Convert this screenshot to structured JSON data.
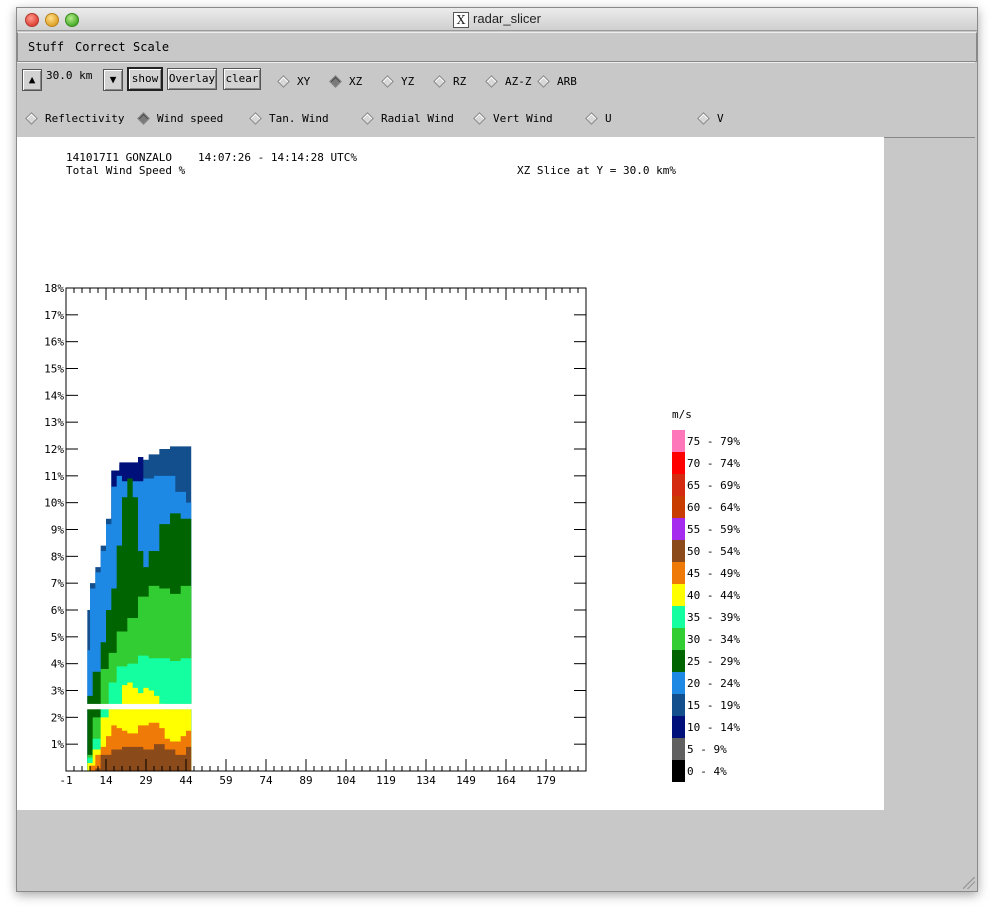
{
  "window": {
    "title": "radar_slicer"
  },
  "menu": [
    "Stuff",
    "Correct",
    "Scale"
  ],
  "toolbar": {
    "up_arrow": "▲",
    "down_arrow": "▼",
    "height_value": "30.0 km",
    "show": "show",
    "overlay": "Overlay",
    "clear": "clear",
    "slice_modes": [
      {
        "label": "XY",
        "selected": false
      },
      {
        "label": "XZ",
        "selected": true
      },
      {
        "label": "YZ",
        "selected": false
      },
      {
        "label": "RZ",
        "selected": false
      },
      {
        "label": "AZ-Z",
        "selected": false
      },
      {
        "label": "ARB",
        "selected": false
      }
    ],
    "fields": [
      {
        "label": "Reflectivity",
        "selected": false
      },
      {
        "label": "Wind speed",
        "selected": true
      },
      {
        "label": "Tan. Wind",
        "selected": false
      },
      {
        "label": "Radial Wind",
        "selected": false
      },
      {
        "label": "Vert Wind",
        "selected": false
      },
      {
        "label": "U",
        "selected": false
      },
      {
        "label": "V",
        "selected": false
      }
    ]
  },
  "plot_header": {
    "flight": "141017I1 GONZALO",
    "time_range": "14:07:26 - 14:14:28 UTC%",
    "field_name": "Total Wind Speed %",
    "slice_desc": "XZ Slice at Y = 30.0 km%"
  },
  "chart_data": {
    "type": "heatmap",
    "xlim": [
      -1,
      194
    ],
    "ylim": [
      0,
      18
    ],
    "x_ticks": [
      "-1",
      "14",
      "29",
      "44",
      "59",
      "74",
      "89",
      "104",
      "119",
      "134",
      "149",
      "164",
      "179"
    ],
    "y_ticks": [
      "1%",
      "2%",
      "3%",
      "4%",
      "5%",
      "6%",
      "7%",
      "8%",
      "9%",
      "10%",
      "11%",
      "12%",
      "13%",
      "14%",
      "15%",
      "16%",
      "17%",
      "18%"
    ],
    "legend_unit": "m/s",
    "legend": [
      {
        "label": "75 - 79%",
        "color": "#ff77bb"
      },
      {
        "label": "70 - 74%",
        "color": "#ff0000"
      },
      {
        "label": "65 - 69%",
        "color": "#d42a10"
      },
      {
        "label": "60 - 64%",
        "color": "#c83c00"
      },
      {
        "label": "55 - 59%",
        "color": "#a52cef"
      },
      {
        "label": "50 - 54%",
        "color": "#8b4a1a"
      },
      {
        "label": "45 - 49%",
        "color": "#ef7a08"
      },
      {
        "label": "40 - 44%",
        "color": "#ffff00"
      },
      {
        "label": "35 - 39%",
        "color": "#14ffa0"
      },
      {
        "label": "30 - 34%",
        "color": "#32cd32"
      },
      {
        "label": "25 - 29%",
        "color": "#006400"
      },
      {
        "label": "20 - 24%",
        "color": "#1e88e5"
      },
      {
        "label": "15 - 19%",
        "color": "#134f8c"
      },
      {
        "label": "10 - 14%",
        "color": "#00107a"
      },
      {
        "label": "5 - 9%",
        "color": "#606060"
      },
      {
        "label": "0 - 4%",
        "color": "#000000"
      }
    ],
    "data_extent": {
      "x_min": 6,
      "x_max": 46,
      "y_max": 12.1,
      "gap_y": [
        2.3,
        2.5
      ]
    },
    "layers": [
      {
        "color": "#134f8c",
        "top": [
          [
            7,
            6.0
          ],
          [
            8,
            7.0
          ],
          [
            10,
            7.6
          ],
          [
            12,
            8.4
          ],
          [
            14,
            9.4
          ],
          [
            16,
            11.2
          ],
          [
            19,
            11.4
          ],
          [
            22,
            11.4
          ],
          [
            26,
            11.6
          ],
          [
            30,
            11.8
          ],
          [
            34,
            12.0
          ],
          [
            38,
            12.1
          ],
          [
            42,
            12.1
          ],
          [
            46,
            11.8
          ]
        ]
      },
      {
        "color": "#00107a",
        "top": [
          [
            16,
            11.2
          ],
          [
            19,
            11.5
          ],
          [
            22,
            11.5
          ],
          [
            26,
            11.7
          ],
          [
            28,
            11.7
          ]
        ]
      },
      {
        "color": "#1e88e5",
        "top": [
          [
            7,
            4.5
          ],
          [
            8,
            6.8
          ],
          [
            10,
            7.4
          ],
          [
            12,
            8.2
          ],
          [
            14,
            9.2
          ],
          [
            16,
            10.6
          ],
          [
            18,
            11.0
          ],
          [
            20,
            10.8
          ],
          [
            24,
            10.8
          ],
          [
            28,
            10.9
          ],
          [
            32,
            11.0
          ],
          [
            36,
            11.0
          ],
          [
            40,
            10.4
          ],
          [
            44,
            10.0
          ],
          [
            46,
            9.3
          ]
        ]
      },
      {
        "color": "#006400",
        "top": [
          [
            7,
            2.8
          ],
          [
            9,
            3.7
          ],
          [
            12,
            4.8
          ],
          [
            14,
            6.0
          ],
          [
            16,
            6.8
          ],
          [
            18,
            8.4
          ],
          [
            20,
            10.2
          ],
          [
            22,
            10.9
          ],
          [
            24,
            10.2
          ],
          [
            26,
            8.2
          ],
          [
            28,
            7.6
          ],
          [
            30,
            8.2
          ],
          [
            34,
            9.2
          ],
          [
            38,
            9.6
          ],
          [
            42,
            9.4
          ],
          [
            46,
            8.8
          ]
        ]
      },
      {
        "color": "#32cd32",
        "top": [
          [
            7,
            0.6
          ],
          [
            9,
            2.0
          ],
          [
            12,
            3.8
          ],
          [
            15,
            4.4
          ],
          [
            18,
            5.2
          ],
          [
            22,
            5.7
          ],
          [
            26,
            6.5
          ],
          [
            30,
            6.9
          ],
          [
            34,
            6.8
          ],
          [
            38,
            6.6
          ],
          [
            42,
            6.9
          ],
          [
            46,
            6.8
          ]
        ]
      },
      {
        "color": "#14ffa0",
        "top": [
          [
            7,
            0.5
          ],
          [
            9,
            1.2
          ],
          [
            12,
            2.3
          ],
          [
            15,
            3.3
          ],
          [
            18,
            3.9
          ],
          [
            22,
            4.0
          ],
          [
            26,
            4.3
          ],
          [
            30,
            4.2
          ],
          [
            34,
            4.2
          ],
          [
            38,
            4.1
          ],
          [
            42,
            4.2
          ],
          [
            46,
            4.1
          ]
        ]
      },
      {
        "color": "#ffff00",
        "top": [
          [
            7,
            0.3
          ],
          [
            9,
            0.8
          ],
          [
            12,
            2.0
          ],
          [
            15,
            2.3
          ],
          [
            18,
            2.3
          ],
          [
            20,
            3.2
          ],
          [
            22,
            3.3
          ],
          [
            24,
            3.1
          ],
          [
            26,
            2.9
          ],
          [
            28,
            3.1
          ],
          [
            30,
            3.0
          ],
          [
            32,
            2.8
          ],
          [
            34,
            2.5
          ],
          [
            36,
            2.3
          ],
          [
            46,
            2.3
          ]
        ]
      },
      {
        "color": "#ef7a08",
        "top": [
          [
            8,
            0.2
          ],
          [
            10,
            0.6
          ],
          [
            12,
            0.9
          ],
          [
            14,
            1.3
          ],
          [
            16,
            1.7
          ],
          [
            18,
            1.6
          ],
          [
            20,
            1.5
          ],
          [
            22,
            1.4
          ],
          [
            26,
            1.7
          ],
          [
            30,
            1.8
          ],
          [
            34,
            1.6
          ],
          [
            36,
            1.2
          ],
          [
            38,
            1.1
          ],
          [
            42,
            1.3
          ],
          [
            44,
            1.5
          ],
          [
            46,
            1.4
          ]
        ]
      },
      {
        "color": "#8b4a1a",
        "top": [
          [
            10,
            0.1
          ],
          [
            12,
            0.6
          ],
          [
            16,
            0.8
          ],
          [
            20,
            0.9
          ],
          [
            24,
            0.9
          ],
          [
            28,
            0.8
          ],
          [
            32,
            1.0
          ],
          [
            36,
            0.8
          ],
          [
            40,
            0.6
          ],
          [
            44,
            0.9
          ],
          [
            46,
            0.8
          ]
        ]
      }
    ]
  }
}
